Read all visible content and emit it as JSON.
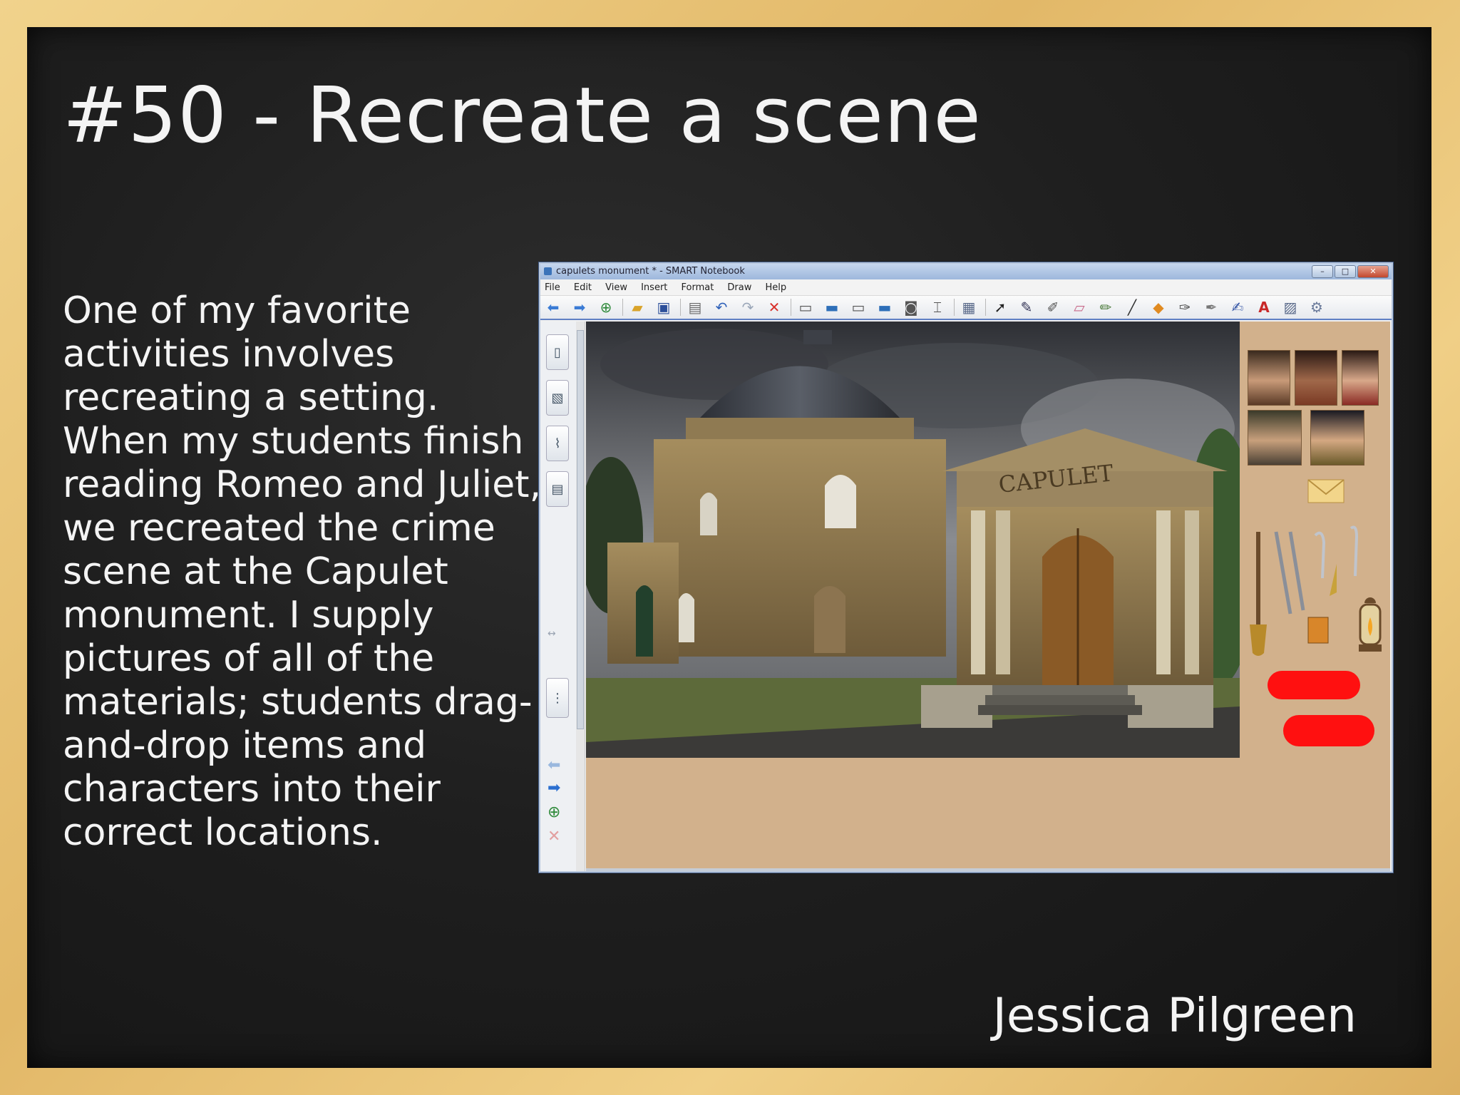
{
  "slide": {
    "title": "#50 - Recreate a scene",
    "body": "One of my favorite activities involves recreating a setting. When my students finish reading Romeo and Juliet, we recreated the crime scene at the Capulet monument. I supply pictures of all of the materials; students drag-and-drop items and characters into their correct locations.",
    "author": "Jessica Pilgreen"
  },
  "window": {
    "title": "capulets monument * - SMART Notebook",
    "menu": [
      "File",
      "Edit",
      "View",
      "Insert",
      "Format",
      "Draw",
      "Help"
    ],
    "toolbar_icons": [
      "back-arrow-icon",
      "forward-arrow-icon",
      "add-page-icon",
      "open-folder-icon",
      "save-icon",
      "paste-icon",
      "undo-icon",
      "redo-icon",
      "delete-icon",
      "screen-shade-icon",
      "display-icon",
      "monitor-icon",
      "screen-capture-icon",
      "camera-icon",
      "document-camera-icon",
      "table-icon",
      "select-arrow-icon",
      "pen-icon",
      "creative-pen-icon",
      "eraser-icon",
      "highlighter-icon",
      "line-icon",
      "shape-icon",
      "fill-icon",
      "magic-pen-icon",
      "magic-brush-icon",
      "text-icon",
      "properties-icon",
      "more-tools-icon"
    ],
    "side_tabs": [
      "page-sorter-tab",
      "gallery-tab",
      "attachments-tab",
      "properties-tab"
    ],
    "image": {
      "building_label": "CAPULET"
    }
  },
  "colors": {
    "chalkboard": "#1f1f1f",
    "frame": "#e8c277",
    "chalk_text": "#f4f4f4",
    "canvas_bg": "#d2b18c",
    "blood_marks": "#ff1010"
  }
}
